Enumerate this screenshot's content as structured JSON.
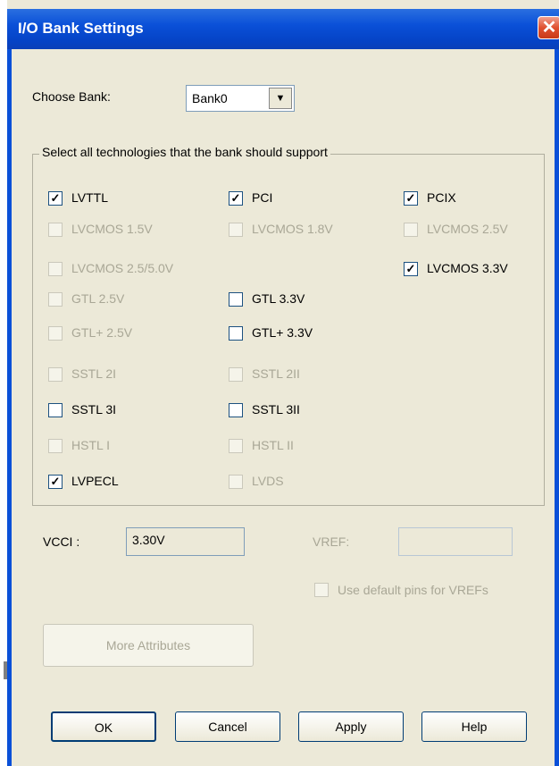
{
  "window": {
    "title": "I/O Bank Settings",
    "close_glyph": "✕"
  },
  "bank": {
    "label": "Choose Bank:",
    "value": "Bank0",
    "arrow": "▼"
  },
  "group": {
    "title": "Select all technologies that the bank should support"
  },
  "technologies": [
    {
      "label": "LVTTL",
      "checked": true,
      "enabled": true
    },
    {
      "label": "PCI",
      "checked": true,
      "enabled": true
    },
    {
      "label": "PCIX",
      "checked": true,
      "enabled": true
    },
    {
      "label": "LVCMOS 1.5V",
      "checked": false,
      "enabled": false
    },
    {
      "label": "LVCMOS 1.8V",
      "checked": false,
      "enabled": false
    },
    {
      "label": "LVCMOS 2.5V",
      "checked": false,
      "enabled": false
    },
    {
      "label": "LVCMOS 2.5/5.0V",
      "checked": false,
      "enabled": false
    },
    {
      "label": "LVCMOS 3.3V",
      "checked": true,
      "enabled": true
    },
    {
      "label": "GTL 2.5V",
      "checked": false,
      "enabled": false
    },
    {
      "label": "GTL 3.3V",
      "checked": false,
      "enabled": true
    },
    {
      "label": "GTL+ 2.5V",
      "checked": false,
      "enabled": false
    },
    {
      "label": "GTL+ 3.3V",
      "checked": false,
      "enabled": true
    },
    {
      "label": "SSTL 2I",
      "checked": false,
      "enabled": false
    },
    {
      "label": "SSTL 2II",
      "checked": false,
      "enabled": false
    },
    {
      "label": "SSTL 3I",
      "checked": false,
      "enabled": true
    },
    {
      "label": "SSTL 3II",
      "checked": false,
      "enabled": true
    },
    {
      "label": "HSTL I",
      "checked": false,
      "enabled": false
    },
    {
      "label": "HSTL II",
      "checked": false,
      "enabled": false
    },
    {
      "label": "LVPECL",
      "checked": true,
      "enabled": true
    },
    {
      "label": "LVDS",
      "checked": false,
      "enabled": false
    }
  ],
  "vcci": {
    "label": "VCCI :",
    "value": "3.30V"
  },
  "vref": {
    "label": "VREF:",
    "value": ""
  },
  "default_pins": {
    "label": "Use default pins for VREFs",
    "checked": false,
    "enabled": false
  },
  "buttons": {
    "more": "More Attributes",
    "ok": "OK",
    "cancel": "Cancel",
    "apply": "Apply",
    "help": "Help"
  },
  "colors": {
    "title_bar": "#0a50d8",
    "dialog_bg": "#ece9d8",
    "disabled_text": "#a9a796"
  }
}
